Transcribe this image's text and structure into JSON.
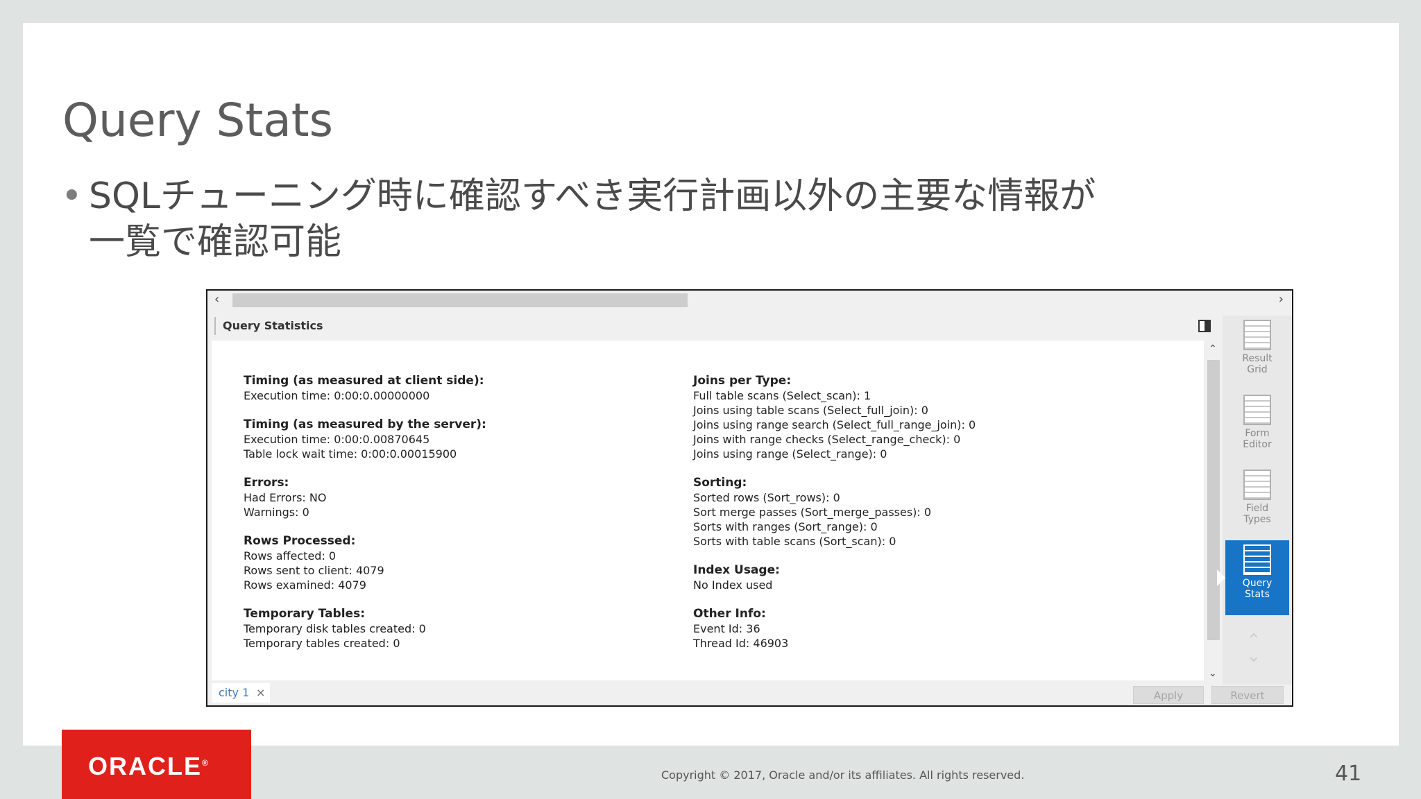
{
  "slide": {
    "title": "Query Stats",
    "bullet_line1": "SQLチューニング時に確認すべき実行計画以外の主要な情報が",
    "bullet_line2": "一覧で確認可能",
    "copyright": "Copyright © 2017, Oracle and/or its affiliates. All rights reserved.",
    "page_number": "41",
    "logo_text": "ORACLE",
    "logo_mark": "®"
  },
  "window": {
    "header_title": "Query Statistics",
    "left_sections": [
      {
        "title": "Timing (as measured at client side):",
        "lines": [
          "Execution time: 0:00:0.00000000"
        ]
      },
      {
        "title": "Timing (as measured by the server):",
        "lines": [
          "Execution time: 0:00:0.00870645",
          "Table lock wait time: 0:00:0.00015900"
        ]
      },
      {
        "title": "Errors:",
        "lines": [
          "Had Errors: NO",
          "Warnings: 0"
        ]
      },
      {
        "title": "Rows Processed:",
        "lines": [
          "Rows affected: 0",
          "Rows sent to client: 4079",
          "Rows examined: 4079"
        ]
      },
      {
        "title": "Temporary Tables:",
        "lines": [
          "Temporary disk tables created: 0",
          "Temporary tables created: 0"
        ]
      }
    ],
    "right_sections": [
      {
        "title": "Joins per Type:",
        "lines": [
          "Full table scans (Select_scan): 1",
          "Joins using table scans (Select_full_join): 0",
          "Joins using range search (Select_full_range_join): 0",
          "Joins with range checks (Select_range_check): 0",
          "Joins using range (Select_range): 0"
        ]
      },
      {
        "title": "Sorting:",
        "lines": [
          "Sorted rows (Sort_rows): 0",
          "Sort merge passes (Sort_merge_passes): 0",
          "Sorts with ranges (Sort_range): 0",
          "Sorts with table scans (Sort_scan): 0"
        ]
      },
      {
        "title": "Index Usage:",
        "lines": [
          "No Index used"
        ]
      },
      {
        "title": "Other Info:",
        "lines": [
          "Event Id: 36",
          "Thread Id: 46903"
        ]
      }
    ],
    "sidebar": [
      {
        "line1": "Result",
        "line2": "Grid"
      },
      {
        "line1": "Form",
        "line2": "Editor"
      },
      {
        "line1": "Field",
        "line2": "Types"
      },
      {
        "line1": "Query",
        "line2": "Stats"
      }
    ],
    "tab_label": "city 1",
    "tab_close": "×",
    "apply_label": "Apply",
    "revert_label": "Revert"
  }
}
